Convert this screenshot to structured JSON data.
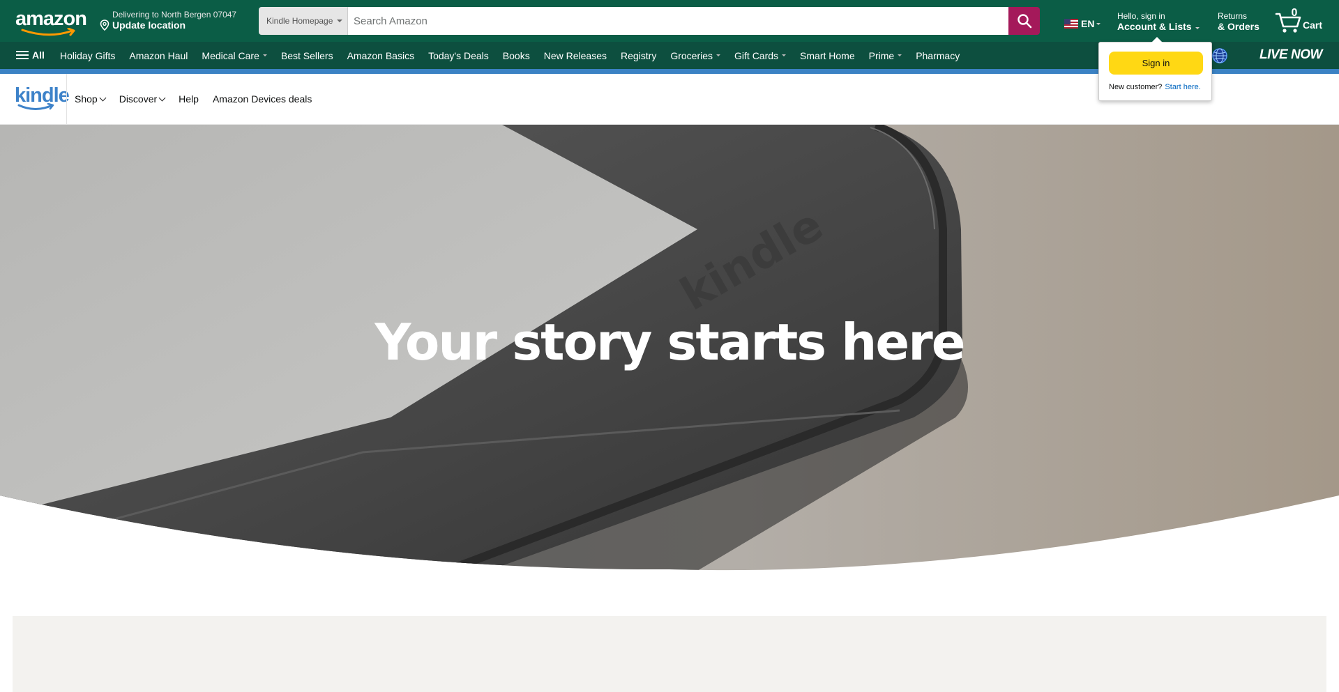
{
  "header": {
    "logo_text": "amazon",
    "deliver_line1": "Delivering to North Bergen 07047",
    "deliver_line2": "Update location",
    "search_dept": "Kindle Homepage",
    "search_placeholder": "Search Amazon",
    "lang": "EN",
    "account_line1": "Hello, sign in",
    "account_line2": "Account & Lists",
    "returns_line1": "Returns",
    "returns_line2": "& Orders",
    "cart_count": "0",
    "cart_label": "Cart"
  },
  "navbar": {
    "all_label": "All",
    "items": [
      {
        "label": "Holiday Gifts",
        "dropdown": false
      },
      {
        "label": "Amazon Haul",
        "dropdown": false
      },
      {
        "label": "Medical Care",
        "dropdown": true
      },
      {
        "label": "Best Sellers",
        "dropdown": false
      },
      {
        "label": "Amazon Basics",
        "dropdown": false
      },
      {
        "label": "Today's Deals",
        "dropdown": false
      },
      {
        "label": "Books",
        "dropdown": false
      },
      {
        "label": "New Releases",
        "dropdown": false
      },
      {
        "label": "Registry",
        "dropdown": false
      },
      {
        "label": "Groceries",
        "dropdown": true
      },
      {
        "label": "Gift Cards",
        "dropdown": true
      },
      {
        "label": "Smart Home",
        "dropdown": false
      },
      {
        "label": "Prime",
        "dropdown": true
      },
      {
        "label": "Pharmacy",
        "dropdown": false
      }
    ],
    "live_now": "LIVE NOW"
  },
  "kindle_bar": {
    "logo_text": "kindle",
    "items": [
      {
        "label": "Shop",
        "dropdown": true
      },
      {
        "label": "Discover",
        "dropdown": true
      },
      {
        "label": "Help",
        "dropdown": false
      },
      {
        "label": "Amazon Devices deals",
        "dropdown": false
      }
    ]
  },
  "hero": {
    "title": "Your story starts here",
    "device_text": "kindle"
  },
  "signin_popover": {
    "button_label": "Sign in",
    "new_customer": "New customer?",
    "start_here": "Start here."
  },
  "colors": {
    "topbar": "#0b5d46",
    "navbar": "#0d4f3f",
    "search_button": "#a4195a",
    "signin_button": "#ffd814",
    "kindle_blue": "#3d82c9"
  }
}
